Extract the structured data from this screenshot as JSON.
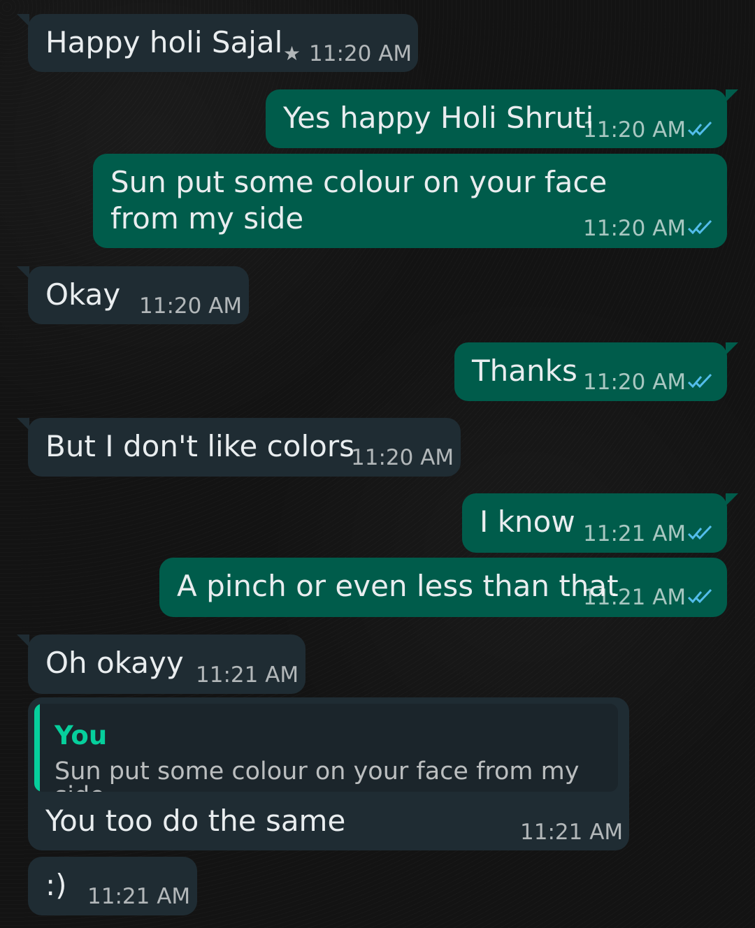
{
  "messages": [
    {
      "direction": "incoming",
      "text": "Happy holi Sajal",
      "time": "11:20 AM",
      "starred": true,
      "star_icon": "star-icon"
    },
    {
      "direction": "outgoing",
      "text": "Yes happy Holi Shruti",
      "time": "11:20 AM",
      "status": "read",
      "ticks_icon": "double-check-icon"
    },
    {
      "direction": "outgoing",
      "text": "Sun put some colour on your face from my side",
      "time": "11:20 AM",
      "status": "read",
      "ticks_icon": "double-check-icon"
    },
    {
      "direction": "incoming",
      "text": "Okay",
      "time": "11:20 AM"
    },
    {
      "direction": "outgoing",
      "text": "Thanks",
      "time": "11:20 AM",
      "status": "read",
      "ticks_icon": "double-check-icon"
    },
    {
      "direction": "incoming",
      "text": "But I don't like colors",
      "time": "11:20 AM"
    },
    {
      "direction": "outgoing",
      "text": "I know",
      "time": "11:21 AM",
      "status": "read",
      "ticks_icon": "double-check-icon"
    },
    {
      "direction": "outgoing",
      "text": "A pinch or even less than that",
      "time": "11:21 AM",
      "status": "read",
      "ticks_icon": "double-check-icon"
    },
    {
      "direction": "incoming",
      "text": "Oh okayy",
      "time": "11:21 AM"
    },
    {
      "direction": "incoming",
      "text": "You too do the same",
      "time": "11:21 AM",
      "quote": {
        "author": "You",
        "text": "Sun put some colour on your face from my side"
      }
    },
    {
      "direction": "incoming",
      "text": ":)",
      "time": "11:21 AM"
    }
  ],
  "colors": {
    "background": "#131313",
    "incoming_bubble": "#1f2c33",
    "outgoing_bubble": "#005c4b",
    "quote_accent": "#06cf9c",
    "read_ticks": "#53bdeb"
  }
}
